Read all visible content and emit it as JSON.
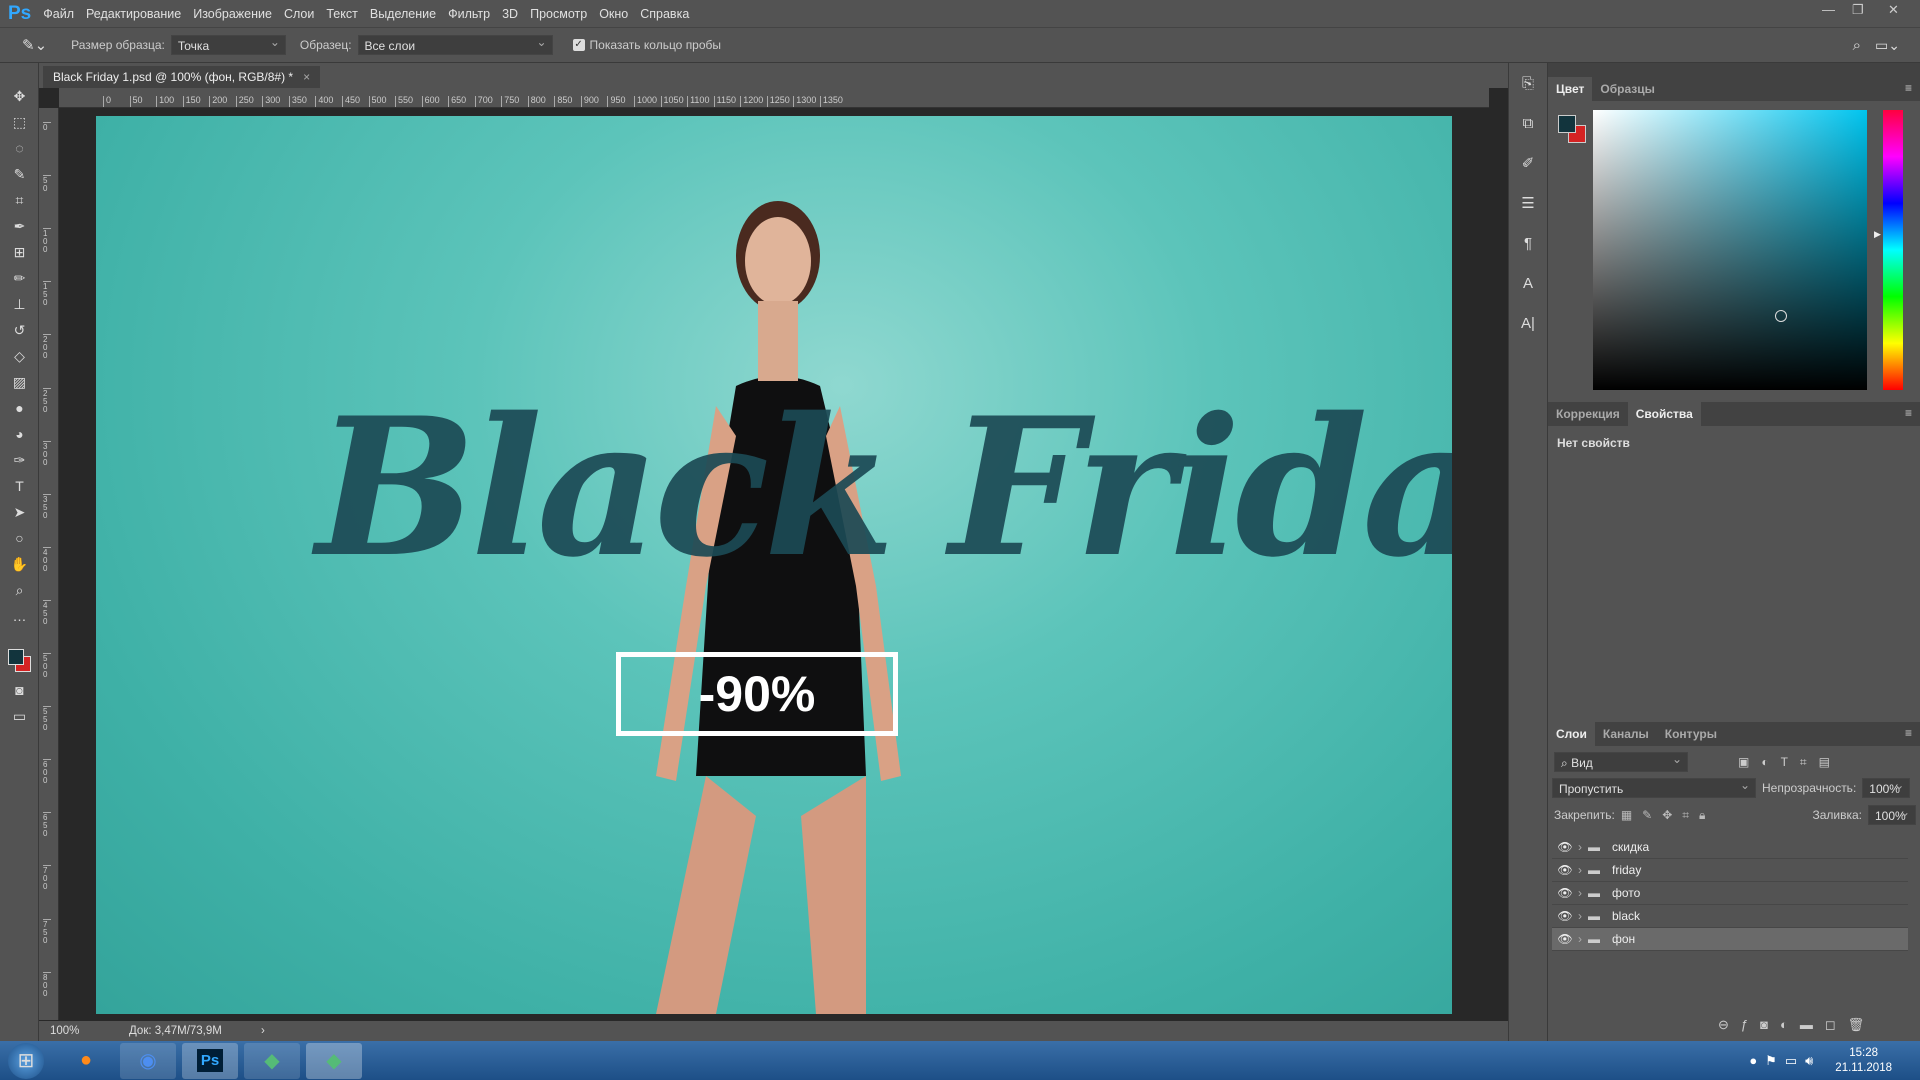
{
  "app": {
    "logo": "Ps",
    "menu": [
      "Файл",
      "Редактирование",
      "Изображение",
      "Слои",
      "Текст",
      "Выделение",
      "Фильтр",
      "3D",
      "Просмотр",
      "Окно",
      "Справка"
    ]
  },
  "options": {
    "sample_size_label": "Размер образца:",
    "sample_size_value": "Точка",
    "sample_label": "Образец:",
    "sample_value": "Все слои",
    "show_ring_label": "Показать кольцо пробы",
    "show_ring_checked": true
  },
  "document": {
    "tab_title": "Black Friday 1.psd @ 100% (фон, RGB/8#) *",
    "close": "×"
  },
  "rulers": {
    "h": [
      0,
      50,
      100,
      150,
      200,
      250,
      300,
      350,
      400,
      450,
      500,
      550,
      600,
      650,
      700,
      750,
      800,
      850,
      900,
      950,
      1000,
      1050,
      1100,
      1150,
      1200,
      1250,
      1300,
      1350
    ],
    "v": [
      0,
      50,
      100,
      150,
      200,
      250,
      300,
      350,
      400,
      450,
      500,
      550,
      600,
      650,
      700,
      750,
      800,
      850
    ]
  },
  "canvas": {
    "headline": "Black Friday",
    "promo": "-90%",
    "bg_color": "#3fb1a7",
    "text_color": "#1c4a55"
  },
  "status": {
    "zoom": "100%",
    "doc": "Док: 3,47M/73,9M",
    "arrow": "›"
  },
  "tools": [
    "move-icon",
    "marquee-icon",
    "lasso-icon",
    "quick-select-icon",
    "crop-icon",
    "eyedropper-icon",
    "patch-icon",
    "brush-icon",
    "stamp-icon",
    "history-brush-icon",
    "eraser-icon",
    "gradient-icon",
    "blur-icon",
    "dodge-icon",
    "pen-icon",
    "type-icon",
    "path-select-icon",
    "ellipse-icon",
    "hand-icon",
    "zoom-icon",
    "more-icon"
  ],
  "color_panel": {
    "tabs": [
      "Цвет",
      "Образцы"
    ],
    "foreground": "#12343d",
    "background": "#d42323"
  },
  "properties_panel": {
    "tabs": [
      "Коррекция",
      "Свойства"
    ],
    "message": "Нет свойств"
  },
  "layers_panel": {
    "tabs": [
      "Слои",
      "Каналы",
      "Контуры"
    ],
    "filter": "Вид",
    "blend_mode": "Пропустить",
    "opacity_label": "Непрозрачность:",
    "opacity": "100%",
    "lock_label": "Закрепить:",
    "fill_label": "Заливка:",
    "fill": "100%",
    "layers": [
      {
        "name": "скидка",
        "selected": false
      },
      {
        "name": "friday",
        "selected": false
      },
      {
        "name": "фото",
        "selected": false
      },
      {
        "name": "black",
        "selected": false
      },
      {
        "name": "фон",
        "selected": true
      }
    ]
  },
  "taskbar": {
    "time": "15:28",
    "date": "21.11.2018"
  }
}
